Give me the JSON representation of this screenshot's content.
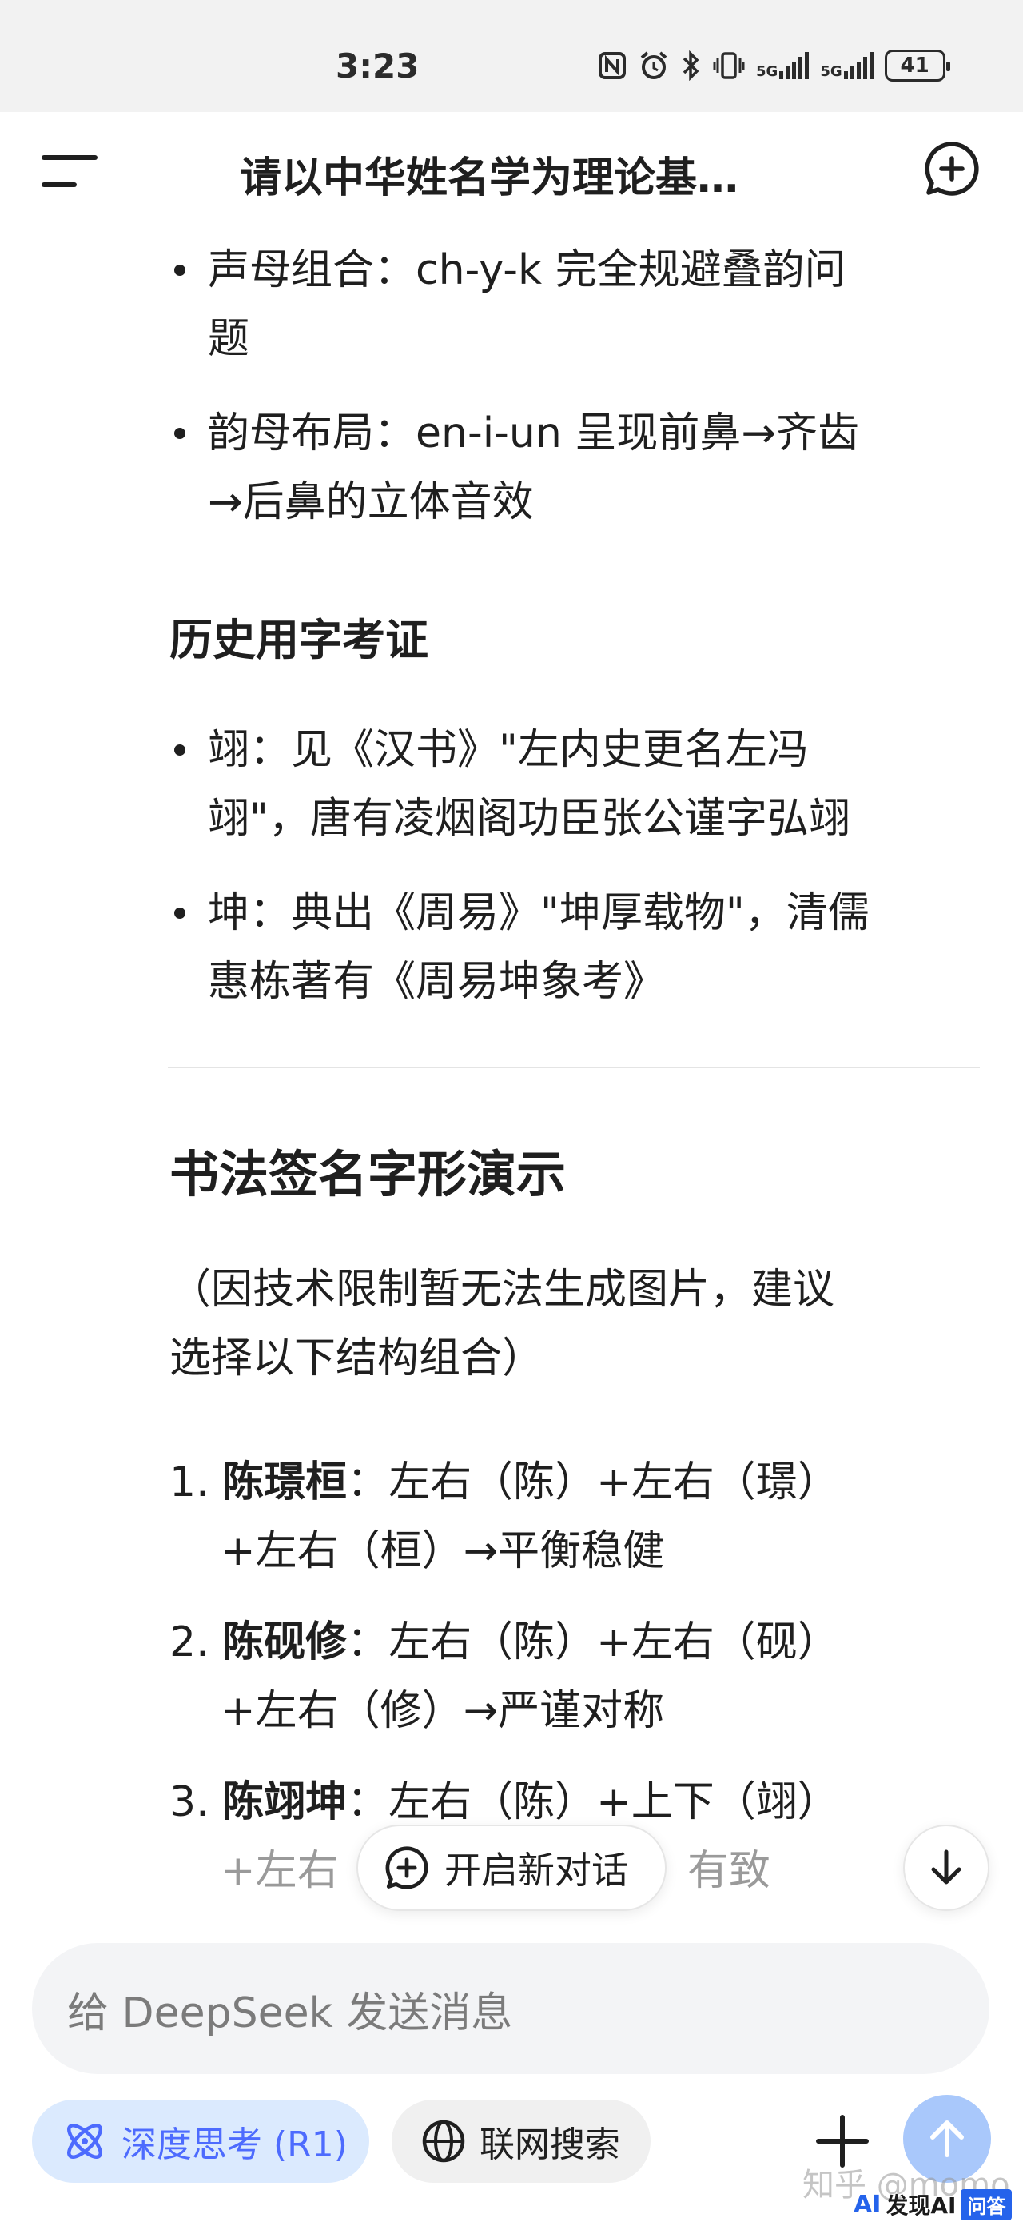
{
  "status_bar": {
    "time": "3:23",
    "network_1": "5G",
    "network_2": "5G",
    "battery": "41",
    "icons": [
      "nfc-icon",
      "alarm-icon",
      "bluetooth-icon",
      "vibrate-icon",
      "signal-icon",
      "signal-icon",
      "battery-icon"
    ]
  },
  "header": {
    "title": "请以中华姓名学为理论基…",
    "menu_icon": "menu-icon",
    "new_chat_icon": "new-chat-icon"
  },
  "content": {
    "tones_bullets": [
      {
        "line1": "声母组合：ch-y-k 完全规避叠韵问",
        "line2": "题"
      },
      {
        "line1": "韵母布局：en-i-un 呈现前鼻→齐齿",
        "line2": "→后鼻的立体音效"
      }
    ],
    "history_heading": "历史用字考证",
    "history_bullets": [
      {
        "line1": "翊：见《汉书》\"左内史更名左冯",
        "line2": "翊\"，唐有凌烟阁功臣张公谨字弘翊"
      },
      {
        "line1": "坤：典出《周易》\"坤厚载物\"，清儒",
        "line2": "惠栋著有《周易坤象考》"
      }
    ],
    "calligraphy_heading": "书法签名字形演示",
    "note_line1": "（因技术限制暂无法生成图片，建议",
    "note_line2": "选择以下结构组合）",
    "list": [
      {
        "num": "1.",
        "name": "陈璟桓",
        "line1_rest": "：左右（陈）+左右（璟）",
        "line2": "+左右（桓）→平衡稳健"
      },
      {
        "num": "2.",
        "name": "陈砚修",
        "line1_rest": "：左右（陈）+左右（砚）",
        "line2": "+左右（修）→严谨对称"
      },
      {
        "num": "3.",
        "name": "陈翊坤",
        "line1_rest": "：左右（陈）+上下（翊）",
        "line2_visible_left": "+左右",
        "line2_visible_right": "有致"
      }
    ]
  },
  "floating": {
    "new_chat_label": "开启新对话",
    "scroll_down_icon": "arrow-down-icon"
  },
  "composer": {
    "placeholder": "给 DeepSeek 发送消息",
    "deep_think_label": "深度思考 (R1)",
    "web_search_label": "联网搜索",
    "plus_icon": "plus-icon",
    "send_icon": "arrow-up-icon"
  },
  "watermark": {
    "text": "知乎 @momo",
    "brand_ai": "AI",
    "brand_text": "发现AI",
    "brand_box": "问答"
  },
  "colors": {
    "accent": "#4d6bfe",
    "accent_bg": "#dbeafe",
    "send_disabled": "#a9c8fb",
    "text": "#1f1f1f",
    "status_bar_bg": "#f2f2f2"
  }
}
